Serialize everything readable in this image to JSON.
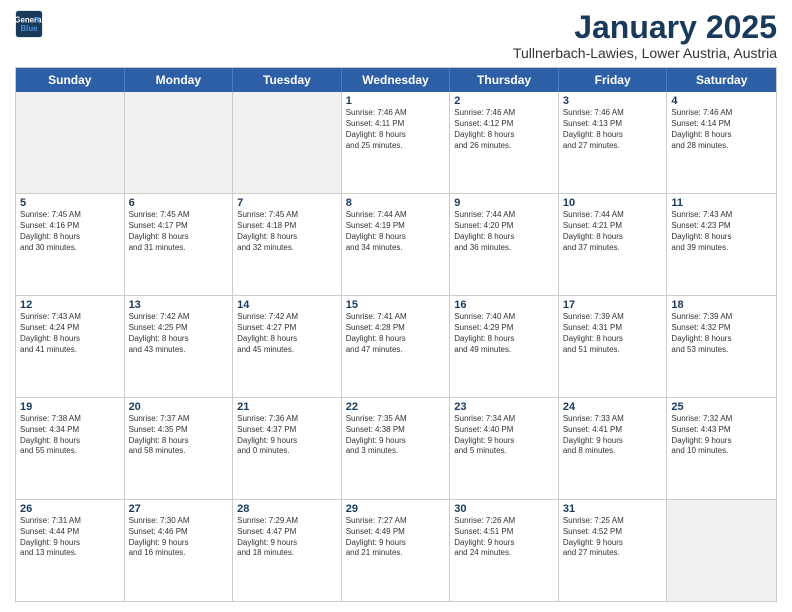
{
  "logo": {
    "line1": "General",
    "line2": "Blue"
  },
  "header": {
    "month": "January 2025",
    "location": "Tullnerbach-Lawies, Lower Austria, Austria"
  },
  "days_of_week": [
    "Sunday",
    "Monday",
    "Tuesday",
    "Wednesday",
    "Thursday",
    "Friday",
    "Saturday"
  ],
  "weeks": [
    [
      {
        "day": "",
        "text": "",
        "shaded": true
      },
      {
        "day": "",
        "text": "",
        "shaded": true
      },
      {
        "day": "",
        "text": "",
        "shaded": true
      },
      {
        "day": "1",
        "text": "Sunrise: 7:46 AM\nSunset: 4:11 PM\nDaylight: 8 hours\nand 25 minutes.",
        "shaded": false
      },
      {
        "day": "2",
        "text": "Sunrise: 7:46 AM\nSunset: 4:12 PM\nDaylight: 8 hours\nand 26 minutes.",
        "shaded": false
      },
      {
        "day": "3",
        "text": "Sunrise: 7:46 AM\nSunset: 4:13 PM\nDaylight: 8 hours\nand 27 minutes.",
        "shaded": false
      },
      {
        "day": "4",
        "text": "Sunrise: 7:46 AM\nSunset: 4:14 PM\nDaylight: 8 hours\nand 28 minutes.",
        "shaded": false
      }
    ],
    [
      {
        "day": "5",
        "text": "Sunrise: 7:45 AM\nSunset: 4:16 PM\nDaylight: 8 hours\nand 30 minutes.",
        "shaded": false
      },
      {
        "day": "6",
        "text": "Sunrise: 7:45 AM\nSunset: 4:17 PM\nDaylight: 8 hours\nand 31 minutes.",
        "shaded": false
      },
      {
        "day": "7",
        "text": "Sunrise: 7:45 AM\nSunset: 4:18 PM\nDaylight: 8 hours\nand 32 minutes.",
        "shaded": false
      },
      {
        "day": "8",
        "text": "Sunrise: 7:44 AM\nSunset: 4:19 PM\nDaylight: 8 hours\nand 34 minutes.",
        "shaded": false
      },
      {
        "day": "9",
        "text": "Sunrise: 7:44 AM\nSunset: 4:20 PM\nDaylight: 8 hours\nand 36 minutes.",
        "shaded": false
      },
      {
        "day": "10",
        "text": "Sunrise: 7:44 AM\nSunset: 4:21 PM\nDaylight: 8 hours\nand 37 minutes.",
        "shaded": false
      },
      {
        "day": "11",
        "text": "Sunrise: 7:43 AM\nSunset: 4:23 PM\nDaylight: 8 hours\nand 39 minutes.",
        "shaded": false
      }
    ],
    [
      {
        "day": "12",
        "text": "Sunrise: 7:43 AM\nSunset: 4:24 PM\nDaylight: 8 hours\nand 41 minutes.",
        "shaded": false
      },
      {
        "day": "13",
        "text": "Sunrise: 7:42 AM\nSunset: 4:25 PM\nDaylight: 8 hours\nand 43 minutes.",
        "shaded": false
      },
      {
        "day": "14",
        "text": "Sunrise: 7:42 AM\nSunset: 4:27 PM\nDaylight: 8 hours\nand 45 minutes.",
        "shaded": false
      },
      {
        "day": "15",
        "text": "Sunrise: 7:41 AM\nSunset: 4:28 PM\nDaylight: 8 hours\nand 47 minutes.",
        "shaded": false
      },
      {
        "day": "16",
        "text": "Sunrise: 7:40 AM\nSunset: 4:29 PM\nDaylight: 8 hours\nand 49 minutes.",
        "shaded": false
      },
      {
        "day": "17",
        "text": "Sunrise: 7:39 AM\nSunset: 4:31 PM\nDaylight: 8 hours\nand 51 minutes.",
        "shaded": false
      },
      {
        "day": "18",
        "text": "Sunrise: 7:39 AM\nSunset: 4:32 PM\nDaylight: 8 hours\nand 53 minutes.",
        "shaded": false
      }
    ],
    [
      {
        "day": "19",
        "text": "Sunrise: 7:38 AM\nSunset: 4:34 PM\nDaylight: 8 hours\nand 55 minutes.",
        "shaded": false
      },
      {
        "day": "20",
        "text": "Sunrise: 7:37 AM\nSunset: 4:35 PM\nDaylight: 8 hours\nand 58 minutes.",
        "shaded": false
      },
      {
        "day": "21",
        "text": "Sunrise: 7:36 AM\nSunset: 4:37 PM\nDaylight: 9 hours\nand 0 minutes.",
        "shaded": false
      },
      {
        "day": "22",
        "text": "Sunrise: 7:35 AM\nSunset: 4:38 PM\nDaylight: 9 hours\nand 3 minutes.",
        "shaded": false
      },
      {
        "day": "23",
        "text": "Sunrise: 7:34 AM\nSunset: 4:40 PM\nDaylight: 9 hours\nand 5 minutes.",
        "shaded": false
      },
      {
        "day": "24",
        "text": "Sunrise: 7:33 AM\nSunset: 4:41 PM\nDaylight: 9 hours\nand 8 minutes.",
        "shaded": false
      },
      {
        "day": "25",
        "text": "Sunrise: 7:32 AM\nSunset: 4:43 PM\nDaylight: 9 hours\nand 10 minutes.",
        "shaded": false
      }
    ],
    [
      {
        "day": "26",
        "text": "Sunrise: 7:31 AM\nSunset: 4:44 PM\nDaylight: 9 hours\nand 13 minutes.",
        "shaded": false
      },
      {
        "day": "27",
        "text": "Sunrise: 7:30 AM\nSunset: 4:46 PM\nDaylight: 9 hours\nand 16 minutes.",
        "shaded": false
      },
      {
        "day": "28",
        "text": "Sunrise: 7:29 AM\nSunset: 4:47 PM\nDaylight: 9 hours\nand 18 minutes.",
        "shaded": false
      },
      {
        "day": "29",
        "text": "Sunrise: 7:27 AM\nSunset: 4:49 PM\nDaylight: 9 hours\nand 21 minutes.",
        "shaded": false
      },
      {
        "day": "30",
        "text": "Sunrise: 7:26 AM\nSunset: 4:51 PM\nDaylight: 9 hours\nand 24 minutes.",
        "shaded": false
      },
      {
        "day": "31",
        "text": "Sunrise: 7:25 AM\nSunset: 4:52 PM\nDaylight: 9 hours\nand 27 minutes.",
        "shaded": false
      },
      {
        "day": "",
        "text": "",
        "shaded": true
      }
    ]
  ]
}
